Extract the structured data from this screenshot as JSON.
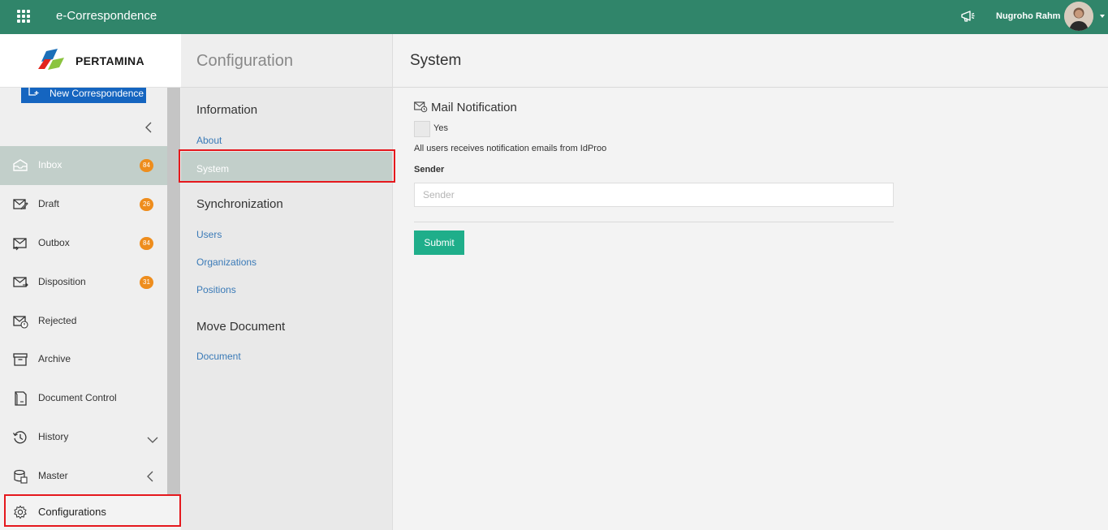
{
  "topbar": {
    "app_title": "e-Correspondence",
    "user_name": "Nugroho Rahm",
    "icons": [
      "apps-grid-icon",
      "megaphone-icon",
      "caret-down-icon"
    ]
  },
  "sidebar": {
    "logo_text": "PERTAMINA",
    "new_button_label": "New Correspondence",
    "items": [
      {
        "label": "Inbox",
        "badge": "84",
        "icon": "inbox-icon",
        "active": true
      },
      {
        "label": "Draft",
        "badge": "26",
        "icon": "draft-icon"
      },
      {
        "label": "Outbox",
        "badge": "84",
        "icon": "outbox-icon"
      },
      {
        "label": "Disposition",
        "badge": "31",
        "icon": "disposition-icon"
      },
      {
        "label": "Rejected",
        "icon": "rejected-icon"
      },
      {
        "label": "Archive",
        "icon": "archive-icon"
      },
      {
        "label": "Document Control",
        "icon": "document-control-icon"
      },
      {
        "label": "History",
        "icon": "history-icon",
        "chevron": "down"
      },
      {
        "label": "Master",
        "icon": "master-icon",
        "chevron": "left"
      }
    ],
    "configurations_label": "Configurations"
  },
  "config_panel": {
    "title": "Configuration",
    "sections": [
      {
        "heading": "Information",
        "links": [
          "About",
          "System"
        ]
      },
      {
        "heading": "Synchronization",
        "links": [
          "Users",
          "Organizations",
          "Positions"
        ]
      },
      {
        "heading": "Move Document",
        "links": [
          "Document"
        ]
      }
    ],
    "active_link": "System"
  },
  "main": {
    "title": "System",
    "mail_heading": "Mail Notification",
    "checkbox_label": "Yes",
    "checkbox_checked": false,
    "notify_text": "All users receives notification emails from IdProo",
    "sender_label": "Sender",
    "sender_placeholder": "Sender",
    "sender_value": "",
    "submit_label": "Submit"
  },
  "colors": {
    "topbar": "#30856a",
    "active_item": "#c2cfca",
    "badge": "#ee8d1d",
    "submit": "#1fae8a",
    "link": "#3a7ab7",
    "highlight": "#e5181d",
    "new_button": "#1565c0"
  }
}
